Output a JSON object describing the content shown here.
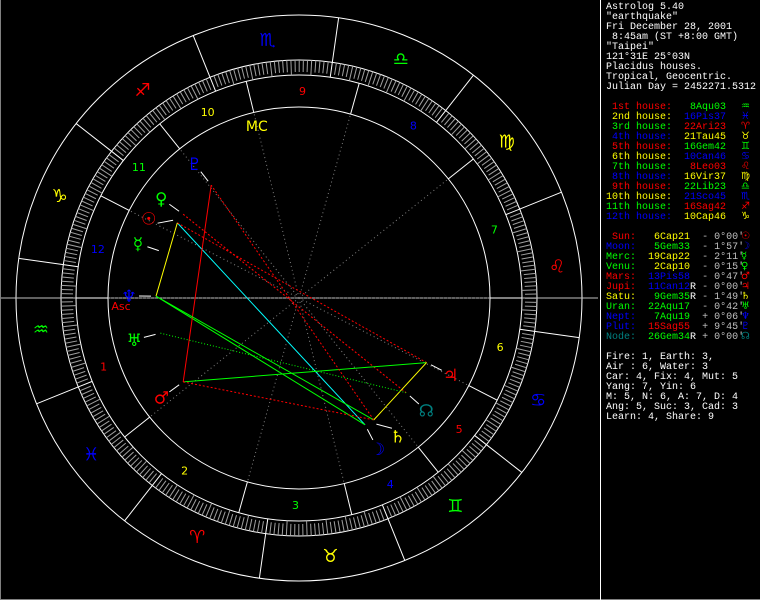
{
  "app": {
    "title": "Astrolog 5.40"
  },
  "info": {
    "name": "\"earthquake\"",
    "date": "Fri December 28, 2001",
    "time": " 8:45am (ST +8:00 GMT)",
    "place": "\"Taipei\"",
    "coords": "121°31E 25°03N",
    "houses": "Placidus houses.",
    "zodiac": "Tropical, Geocentric.",
    "julian": "Julian Day = 2452271.5312"
  },
  "colors": {
    "fire": "#ff0000",
    "earth": "#ffff00",
    "air": "#00ff00",
    "water": "#0000ff",
    "node": "#008080",
    "text": "#ffffff",
    "lat": "#c0c0c0",
    "ring": "#ffffff",
    "tick": "#a0a0a0"
  },
  "signs": [
    {
      "abbr": "Ari",
      "glyph": "♈",
      "element": "fire"
    },
    {
      "abbr": "Tau",
      "glyph": "♉",
      "element": "earth"
    },
    {
      "abbr": "Gem",
      "glyph": "♊",
      "element": "air"
    },
    {
      "abbr": "Can",
      "glyph": "♋",
      "element": "water"
    },
    {
      "abbr": "Leo",
      "glyph": "♌",
      "element": "fire"
    },
    {
      "abbr": "Vir",
      "glyph": "♍",
      "element": "earth"
    },
    {
      "abbr": "Lib",
      "glyph": "♎",
      "element": "air"
    },
    {
      "abbr": "Sco",
      "glyph": "♏",
      "element": "water"
    },
    {
      "abbr": "Sag",
      "glyph": "♐",
      "element": "fire"
    },
    {
      "abbr": "Cap",
      "glyph": "♑",
      "element": "earth"
    },
    {
      "abbr": "Aqu",
      "glyph": "♒",
      "element": "air"
    },
    {
      "abbr": "Pis",
      "glyph": "♓",
      "element": "water"
    }
  ],
  "houses": [
    {
      "num": "1",
      "label": " 1st house:",
      "pos": " 8Aqu03",
      "lon": 308.05,
      "color": "fire",
      "sign": 10
    },
    {
      "num": "2",
      "label": " 2nd house:",
      "pos": "16Pis37",
      "lon": 346.62,
      "color": "earth",
      "sign": 11
    },
    {
      "num": "3",
      "label": " 3rd house:",
      "pos": "22Ari23",
      "lon": 22.38,
      "color": "air",
      "sign": 0
    },
    {
      "num": "4",
      "label": " 4th house:",
      "pos": "21Tau45",
      "lon": 51.75,
      "color": "water",
      "sign": 1
    },
    {
      "num": "5",
      "label": " 5th house:",
      "pos": "16Gem42",
      "lon": 76.7,
      "color": "fire",
      "sign": 2
    },
    {
      "num": "6",
      "label": " 6th house:",
      "pos": "10Can46",
      "lon": 100.77,
      "color": "earth",
      "sign": 3
    },
    {
      "num": "7",
      "label": " 7th house:",
      "pos": " 8Leo03",
      "lon": 128.05,
      "color": "air",
      "sign": 4
    },
    {
      "num": "8",
      "label": " 8th house:",
      "pos": "16Vir37",
      "lon": 166.62,
      "color": "water",
      "sign": 5
    },
    {
      "num": "9",
      "label": " 9th house:",
      "pos": "22Lib23",
      "lon": 202.38,
      "color": "fire",
      "sign": 6
    },
    {
      "num": "10",
      "label": "10th house:",
      "pos": "21Sco45",
      "lon": 231.75,
      "color": "earth",
      "sign": 7
    },
    {
      "num": "11",
      "label": "11th house:",
      "pos": "16Sag42",
      "lon": 256.7,
      "color": "air",
      "sign": 8
    },
    {
      "num": "12",
      "label": "12th house:",
      "pos": "10Cap46",
      "lon": 280.77,
      "color": "water",
      "sign": 9
    }
  ],
  "angles": {
    "asc": "Asc",
    "mc": "MC"
  },
  "planets": [
    {
      "name": "Sun",
      "label": " Sun:",
      "pos": " 6Cap21",
      "retro": " ",
      "lat": "- 0°00'",
      "lon": 276.35,
      "glyph": "☉",
      "color": "fire",
      "sign": 9
    },
    {
      "name": "Moon",
      "label": "Moon:",
      "pos": " 5Gem33",
      "retro": " ",
      "lat": "- 1°57'",
      "lon": 65.55,
      "glyph": "☽",
      "color": "water",
      "sign": 2
    },
    {
      "name": "Mercury",
      "label": "Merc:",
      "pos": "19Cap22",
      "retro": " ",
      "lat": "- 2°11'",
      "lon": 289.37,
      "glyph": "☿",
      "color": "air",
      "sign": 9
    },
    {
      "name": "Venus",
      "label": "Venu:",
      "pos": " 2Cap10",
      "retro": " ",
      "lat": "- 0°15'",
      "lon": 272.17,
      "glyph": "♀",
      "color": "air",
      "sign": 9
    },
    {
      "name": "Mars",
      "label": "Mars:",
      "pos": "13Pis58",
      "retro": " ",
      "lat": "- 0°47'",
      "lon": 343.97,
      "glyph": "♂",
      "color": "fire",
      "sign": 11
    },
    {
      "name": "Jupiter",
      "label": "Jupi:",
      "pos": "11Can12",
      "retro": "R",
      "lat": "- 0°00'",
      "lon": 101.2,
      "glyph": "♃",
      "color": "fire",
      "sign": 3
    },
    {
      "name": "Saturn",
      "label": "Satu:",
      "pos": " 9Gem35",
      "retro": "R",
      "lat": "- 1°49'",
      "lon": 69.58,
      "glyph": "♄",
      "color": "earth",
      "sign": 2
    },
    {
      "name": "Uranus",
      "label": "Uran:",
      "pos": "22Aqu17",
      "retro": " ",
      "lat": "- 0°42'",
      "lon": 322.28,
      "glyph": "♅",
      "color": "air",
      "sign": 10
    },
    {
      "name": "Neptune",
      "label": "Nept:",
      "pos": " 7Aqu19",
      "retro": " ",
      "lat": "+ 0°06'",
      "lon": 307.32,
      "glyph": "♆",
      "color": "water",
      "sign": 10
    },
    {
      "name": "Pluto",
      "label": "Plut:",
      "pos": "15Sag55",
      "retro": " ",
      "lat": "+ 9°45'",
      "lon": 255.92,
      "glyph": "♇",
      "color": "water",
      "sign": 8
    },
    {
      "name": "Node",
      "label": "Node:",
      "pos": "26Gem34",
      "retro": "R",
      "lat": "+ 0°00'",
      "lon": 86.57,
      "glyph": "☊",
      "color": "node",
      "sign": 2
    }
  ],
  "stats": [
    "Fire: 1, Earth: 3,",
    "Air : 6, Water: 3",
    "Car: 4, Fix: 4, Mut: 5",
    "Yang: 7, Yin: 6",
    "M: 5, N: 6, A: 7, D: 4",
    "Ang: 5, Suc: 3, Cad: 3",
    "Learn: 4, Share: 9"
  ]
}
